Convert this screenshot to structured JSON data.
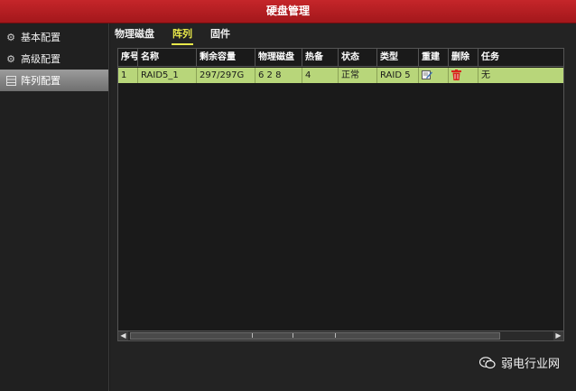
{
  "window": {
    "title": "硬盘管理"
  },
  "sidebar": {
    "items": [
      {
        "label": "基本配置",
        "icon": "gear-icon"
      },
      {
        "label": "高级配置",
        "icon": "gear-icon"
      },
      {
        "label": "阵列配置",
        "icon": "array-icon"
      }
    ],
    "active_index": 2
  },
  "tabs": [
    {
      "label": "物理磁盘"
    },
    {
      "label": "阵列"
    },
    {
      "label": "固件"
    }
  ],
  "active_tab": 1,
  "table": {
    "columns": [
      "序号",
      "名称",
      "剩余容量",
      "物理磁盘",
      "热备",
      "状态",
      "类型",
      "重建",
      "删除",
      "任务"
    ],
    "rows": [
      {
        "index": "1",
        "name": "RAID5_1",
        "free": "297/297G",
        "disks": "6 2 8",
        "hot_spare": "4",
        "status": "正常",
        "type": "RAID 5",
        "rebuild_icon": "edit-icon",
        "delete_icon": "trash-icon",
        "task": "无"
      }
    ]
  },
  "watermark": {
    "text": "弱电行业网"
  },
  "colors": {
    "titlebar": "#b81e22",
    "row_highlight": "#b8d67a",
    "active_tab": "#e8e84a"
  }
}
